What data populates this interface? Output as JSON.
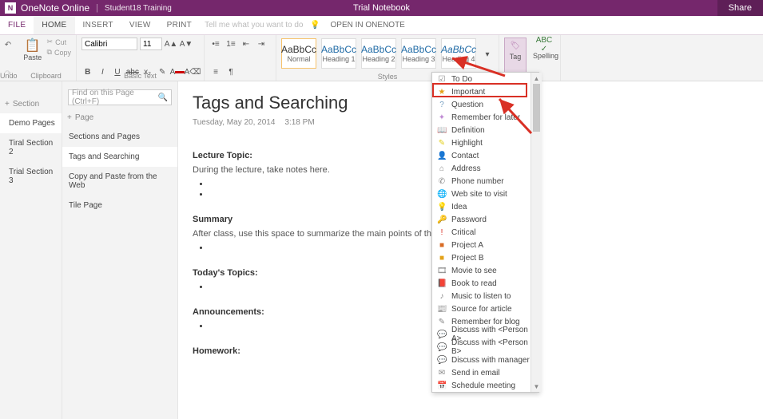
{
  "titlebar": {
    "app": "OneNote Online",
    "student": "Student18 Training",
    "notebook": "Trial Notebook",
    "share": "Share"
  },
  "menu": {
    "tabs": [
      "FILE",
      "HOME",
      "INSERT",
      "VIEW",
      "PRINT"
    ],
    "tellme": "Tell me what you want to do",
    "open_in": "OPEN IN ONENOTE"
  },
  "ribbon": {
    "undo": "Undo",
    "clipboard": {
      "paste": "Paste",
      "cut": "Cut",
      "copy": "Copy",
      "label": "Clipboard"
    },
    "font": {
      "name": "Calibri",
      "size": "11",
      "label": "Basic Text"
    },
    "styles": {
      "label": "Styles",
      "items": [
        {
          "key": "normal",
          "preview": "AaBbCc",
          "name": "Normal"
        },
        {
          "key": "h1",
          "preview": "AaBbCc",
          "name": "Heading 1"
        },
        {
          "key": "h2",
          "preview": "AaBbCc",
          "name": "Heading 2"
        },
        {
          "key": "h3",
          "preview": "AaBbCc",
          "name": "Heading 3"
        },
        {
          "key": "h4",
          "preview": "AaBbCc",
          "name": "Heading 4"
        }
      ]
    },
    "tag": {
      "label": "Tag"
    },
    "spelling": {
      "label": "Spelling"
    }
  },
  "nav": {
    "section_label": "Section",
    "page_label": "Page",
    "sections": [
      "Demo Pages",
      "Tiral Section 2",
      "Trial Section 3"
    ],
    "pages": [
      "Sections and Pages",
      "Tags and Searching",
      "Copy and Paste from the Web",
      "Tile Page"
    ],
    "search_placeholder": "Find on this Page (Ctrl+F)"
  },
  "page": {
    "title": "Tags and Searching",
    "date": "Tuesday, May 20, 2014",
    "time": "3:18 PM",
    "sections": {
      "lecture_h": "Lecture Topic:",
      "lecture_p": "During the lecture, take notes here.",
      "summary_h": "Summary",
      "summary_p": "After class, use this space to summarize the main points of this Lecture Topic.",
      "today_h": "Today's Topics:",
      "ann_h": "Announcements:",
      "hw_h": "Homework:"
    }
  },
  "tags": [
    {
      "icon": "☑",
      "label": "To Do",
      "color": "#888"
    },
    {
      "icon": "★",
      "label": "Important",
      "color": "#e3a21a"
    },
    {
      "icon": "?",
      "label": "Question",
      "color": "#7aa2c4"
    },
    {
      "icon": "✦",
      "label": "Remember for later",
      "color": "#c08bd4"
    },
    {
      "icon": "📖",
      "label": "Definition",
      "color": "#7aa24a"
    },
    {
      "icon": "✎",
      "label": "Highlight",
      "color": "#e3cf1a"
    },
    {
      "icon": "👤",
      "label": "Contact",
      "color": "#888"
    },
    {
      "icon": "⌂",
      "label": "Address",
      "color": "#888"
    },
    {
      "icon": "✆",
      "label": "Phone number",
      "color": "#888"
    },
    {
      "icon": "🌐",
      "label": "Web site to visit",
      "color": "#888"
    },
    {
      "icon": "💡",
      "label": "Idea",
      "color": "#e3a21a"
    },
    {
      "icon": "🔑",
      "label": "Password",
      "color": "#888"
    },
    {
      "icon": "!",
      "label": "Critical",
      "color": "#d93025"
    },
    {
      "icon": "■",
      "label": "Project A",
      "color": "#d96c25"
    },
    {
      "icon": "■",
      "label": "Project B",
      "color": "#e3a21a"
    },
    {
      "icon": "🎞",
      "label": "Movie to see",
      "color": "#888"
    },
    {
      "icon": "📕",
      "label": "Book to read",
      "color": "#888"
    },
    {
      "icon": "♪",
      "label": "Music to listen to",
      "color": "#888"
    },
    {
      "icon": "📰",
      "label": "Source for article",
      "color": "#888"
    },
    {
      "icon": "✎",
      "label": "Remember for blog",
      "color": "#888"
    },
    {
      "icon": "💬",
      "label": "Discuss with <Person A>",
      "color": "#888"
    },
    {
      "icon": "💬",
      "label": "Discuss with <Person B>",
      "color": "#888"
    },
    {
      "icon": "💬",
      "label": "Discuss with manager",
      "color": "#888"
    },
    {
      "icon": "✉",
      "label": "Send in email",
      "color": "#888"
    },
    {
      "icon": "📅",
      "label": "Schedule meeting",
      "color": "#888"
    }
  ]
}
